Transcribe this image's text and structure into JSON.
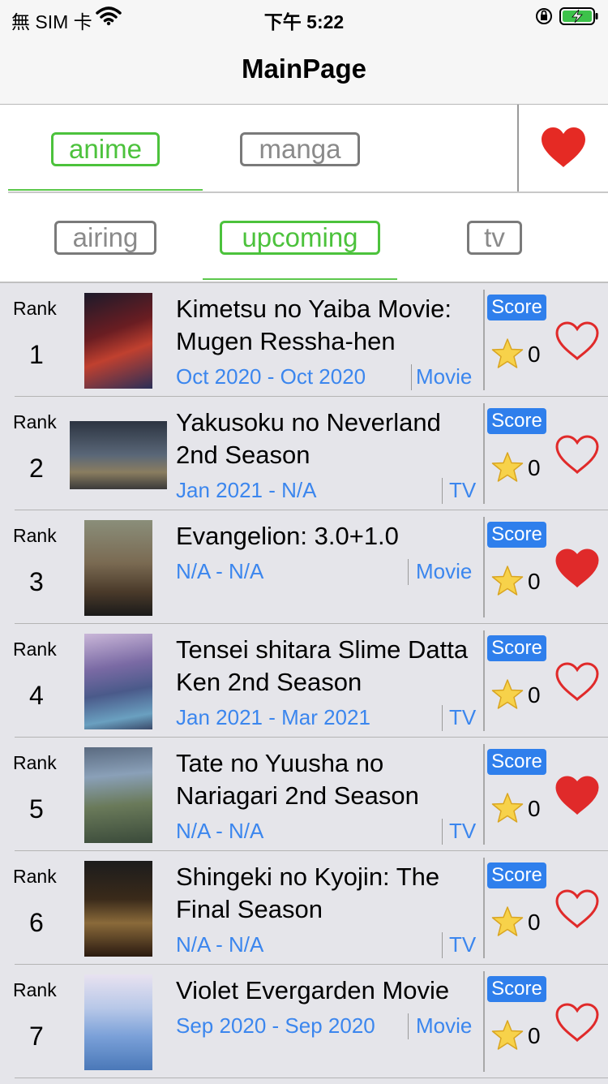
{
  "status_bar": {
    "carrier": "無 SIM 卡",
    "time": "下午 5:22"
  },
  "nav": {
    "title": "MainPage"
  },
  "media_tabs": [
    {
      "label": "anime",
      "active": true
    },
    {
      "label": "manga",
      "active": false
    }
  ],
  "favorites_icon": "heart-filled-icon",
  "filter_tabs": [
    {
      "label": "airing",
      "active": false
    },
    {
      "label": "upcoming",
      "active": true
    },
    {
      "label": "tv",
      "active": false
    }
  ],
  "list_labels": {
    "rank": "Rank",
    "score": "Score"
  },
  "items": [
    {
      "rank": "1",
      "title": "Kimetsu no Yaiba Movie: Mugen Ressha-hen",
      "date": "Oct 2020 - Oct 2020",
      "type": "Movie",
      "score": "0",
      "favorite": false
    },
    {
      "rank": "2",
      "title": "Yakusoku no Neverland 2nd Season",
      "date": "Jan 2021 - N/A",
      "type": "TV",
      "score": "0",
      "favorite": false
    },
    {
      "rank": "3",
      "title": "Evangelion: 3.0+1.0",
      "date": "N/A - N/A",
      "type": "Movie",
      "score": "0",
      "favorite": true
    },
    {
      "rank": "4",
      "title": "Tensei shitara Slime Datta Ken 2nd Season",
      "date": "Jan 2021 - Mar 2021",
      "type": "TV",
      "score": "0",
      "favorite": false
    },
    {
      "rank": "5",
      "title": "Tate no Yuusha no Nariagari 2nd Season",
      "date": "N/A - N/A",
      "type": "TV",
      "score": "0",
      "favorite": true
    },
    {
      "rank": "6",
      "title": "Shingeki no Kyojin: The Final Season",
      "date": "N/A - N/A",
      "type": "TV",
      "score": "0",
      "favorite": false
    },
    {
      "rank": "7",
      "title": "Violet Evergarden Movie",
      "date": "Sep 2020 - Sep 2020",
      "type": "Movie",
      "score": "0",
      "favorite": false
    }
  ],
  "colors": {
    "accent_green": "#4cc23c",
    "link_blue": "#3b86ee",
    "score_badge": "#2f7fec",
    "heart_red": "#e02a2a",
    "list_bg": "#e5e5ea"
  }
}
